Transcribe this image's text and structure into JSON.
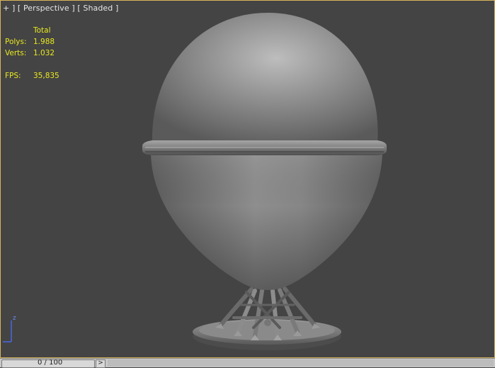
{
  "viewport": {
    "label_parts": [
      "+",
      "] [",
      "Perspective",
      "] [",
      "Shaded",
      "]"
    ],
    "stats": {
      "header": "Total",
      "polys_label": "Polys:",
      "polys_value": "1.988",
      "verts_label": "Verts:",
      "verts_value": "1.032",
      "fps_label": "FPS:",
      "fps_value": "35,835"
    },
    "axis_label": "z",
    "colors": {
      "background": "#444444",
      "border": "#d8b45a",
      "stats_text": "#e8e820",
      "axis_z": "#4a66e0"
    }
  },
  "timeline": {
    "frame_readout": "0 / 100",
    "next_label": ">"
  }
}
